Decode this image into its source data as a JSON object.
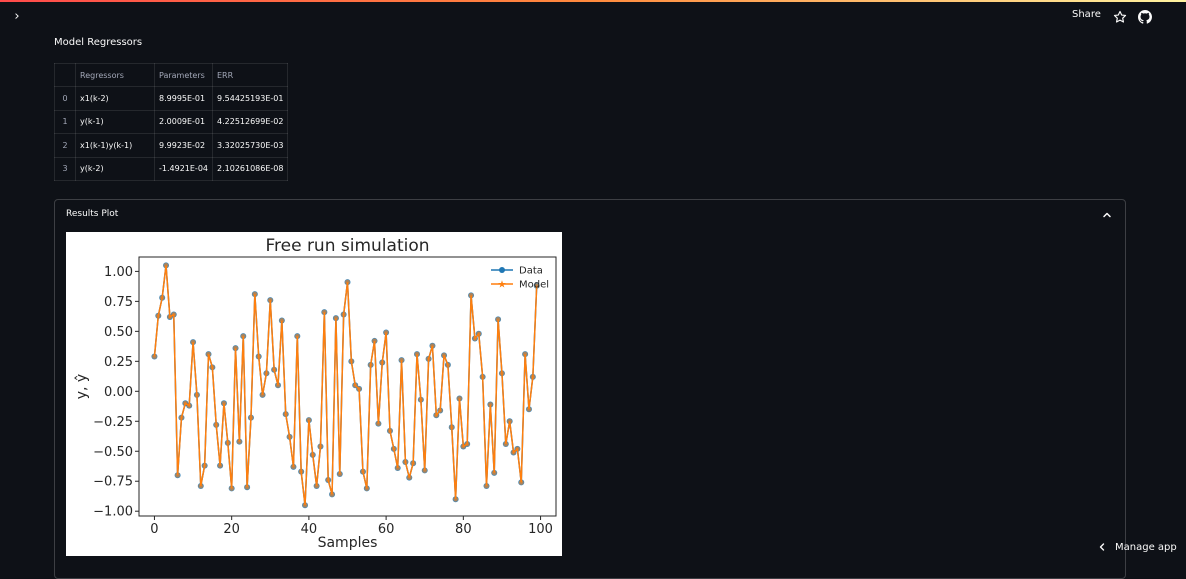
{
  "header": {
    "share_label": "Share",
    "sidebar_toggle_glyph": "›",
    "icons": {
      "sidebar": "chevron-right-icon",
      "star": "star-icon",
      "github": "github-icon"
    }
  },
  "regressors": {
    "title": "Model Regressors",
    "columns": [
      "",
      "Regressors",
      "Parameters",
      "ERR"
    ],
    "rows": [
      [
        "0",
        "x1(k-2)",
        "8.9995E-01",
        "9.54425193E-01"
      ],
      [
        "1",
        "y(k-1)",
        "2.0009E-01",
        "4.22512699E-02"
      ],
      [
        "2",
        "x1(k-1)y(k-1)",
        "9.9923E-02",
        "3.32025730E-03"
      ],
      [
        "3",
        "y(k-2)",
        "-1.4921E-04",
        "2.10261086E-08"
      ]
    ]
  },
  "results": {
    "title": "Results Plot",
    "expanded": true
  },
  "manage_app": {
    "label": "Manage app"
  },
  "colors": {
    "background": "#0e1117",
    "text": "#fafafa",
    "muted_text": "#a3a8b8",
    "data_series": "#1f77b4",
    "model_series": "#ff7f0e"
  },
  "chart_data": {
    "type": "line",
    "title": "Free run simulation",
    "xlabel": "Samples",
    "ylabel": "y, ŷ",
    "xlim": [
      -4,
      104
    ],
    "ylim": [
      -1.04,
      1.12
    ],
    "xticks": [
      0,
      20,
      40,
      60,
      80,
      100
    ],
    "xtick_labels": [
      "0",
      "20",
      "40",
      "60",
      "80",
      "100"
    ],
    "yticks": [
      1.0,
      0.75,
      0.5,
      0.25,
      0.0,
      -0.25,
      -0.5,
      -0.75,
      -1.0
    ],
    "ytick_labels": [
      "1.00",
      "0.75",
      "0.50",
      "0.25",
      "0.00",
      "−0.25",
      "−0.50",
      "−0.75",
      "−1.00"
    ],
    "legend_position": "top-right",
    "grid": false,
    "x": [
      0,
      1,
      2,
      3,
      4,
      5,
      6,
      7,
      8,
      9,
      10,
      11,
      12,
      13,
      14,
      15,
      16,
      17,
      18,
      19,
      20,
      21,
      22,
      23,
      24,
      25,
      26,
      27,
      28,
      29,
      30,
      31,
      32,
      33,
      34,
      35,
      36,
      37,
      38,
      39,
      40,
      41,
      42,
      43,
      44,
      45,
      46,
      47,
      48,
      49,
      50,
      51,
      52,
      53,
      54,
      55,
      56,
      57,
      58,
      59,
      60,
      61,
      62,
      63,
      64,
      65,
      66,
      67,
      68,
      69,
      70,
      71,
      72,
      73,
      74,
      75,
      76,
      77,
      78,
      79,
      80,
      81,
      82,
      83,
      84,
      85,
      86,
      87,
      88,
      89,
      90,
      91,
      92,
      93,
      94,
      95,
      96,
      97,
      98,
      99
    ],
    "series": [
      {
        "name": "Data",
        "marker": "circle",
        "values": [
          0.29,
          0.63,
          0.78,
          1.05,
          0.62,
          0.64,
          -0.7,
          -0.22,
          -0.1,
          -0.12,
          0.41,
          -0.03,
          -0.79,
          -0.62,
          0.31,
          0.2,
          -0.28,
          -0.62,
          -0.1,
          -0.43,
          -0.81,
          0.36,
          -0.42,
          0.46,
          -0.8,
          -0.22,
          0.81,
          0.29,
          -0.03,
          0.15,
          0.76,
          0.18,
          0.05,
          0.59,
          -0.19,
          -0.38,
          -0.63,
          0.46,
          -0.67,
          -0.95,
          -0.24,
          -0.53,
          -0.79,
          -0.46,
          0.66,
          -0.74,
          -0.86,
          0.61,
          -0.69,
          0.64,
          0.91,
          0.25,
          0.05,
          0.02,
          -0.67,
          -0.81,
          0.22,
          0.42,
          -0.27,
          0.24,
          0.49,
          -0.33,
          -0.48,
          -0.64,
          0.26,
          -0.59,
          -0.72,
          -0.6,
          0.31,
          -0.07,
          -0.66,
          0.27,
          0.38,
          -0.2,
          -0.16,
          0.3,
          0.22,
          -0.3,
          -0.9,
          -0.06,
          -0.46,
          -0.44,
          0.8,
          0.44,
          0.48,
          0.12,
          -0.79,
          -0.11,
          -0.68,
          0.6,
          0.15,
          -0.44,
          -0.25,
          -0.51,
          -0.48,
          -0.76,
          0.31,
          -0.15,
          0.12,
          0.88
        ]
      },
      {
        "name": "Model",
        "marker": "star",
        "values": [
          0.29,
          0.63,
          0.78,
          1.05,
          0.62,
          0.64,
          -0.7,
          -0.22,
          -0.1,
          -0.12,
          0.41,
          -0.03,
          -0.79,
          -0.62,
          0.31,
          0.2,
          -0.28,
          -0.62,
          -0.1,
          -0.43,
          -0.81,
          0.36,
          -0.42,
          0.46,
          -0.8,
          -0.22,
          0.81,
          0.29,
          -0.03,
          0.15,
          0.76,
          0.18,
          0.05,
          0.59,
          -0.19,
          -0.38,
          -0.63,
          0.46,
          -0.67,
          -0.95,
          -0.24,
          -0.53,
          -0.79,
          -0.46,
          0.66,
          -0.74,
          -0.86,
          0.61,
          -0.69,
          0.64,
          0.91,
          0.25,
          0.05,
          0.02,
          -0.67,
          -0.81,
          0.22,
          0.42,
          -0.27,
          0.24,
          0.49,
          -0.33,
          -0.48,
          -0.64,
          0.26,
          -0.59,
          -0.72,
          -0.6,
          0.31,
          -0.07,
          -0.66,
          0.27,
          0.38,
          -0.2,
          -0.16,
          0.3,
          0.22,
          -0.3,
          -0.9,
          -0.06,
          -0.46,
          -0.44,
          0.8,
          0.44,
          0.48,
          0.12,
          -0.79,
          -0.11,
          -0.68,
          0.6,
          0.15,
          -0.44,
          -0.25,
          -0.51,
          -0.48,
          -0.76,
          0.31,
          -0.15,
          0.12,
          0.88
        ]
      }
    ]
  }
}
